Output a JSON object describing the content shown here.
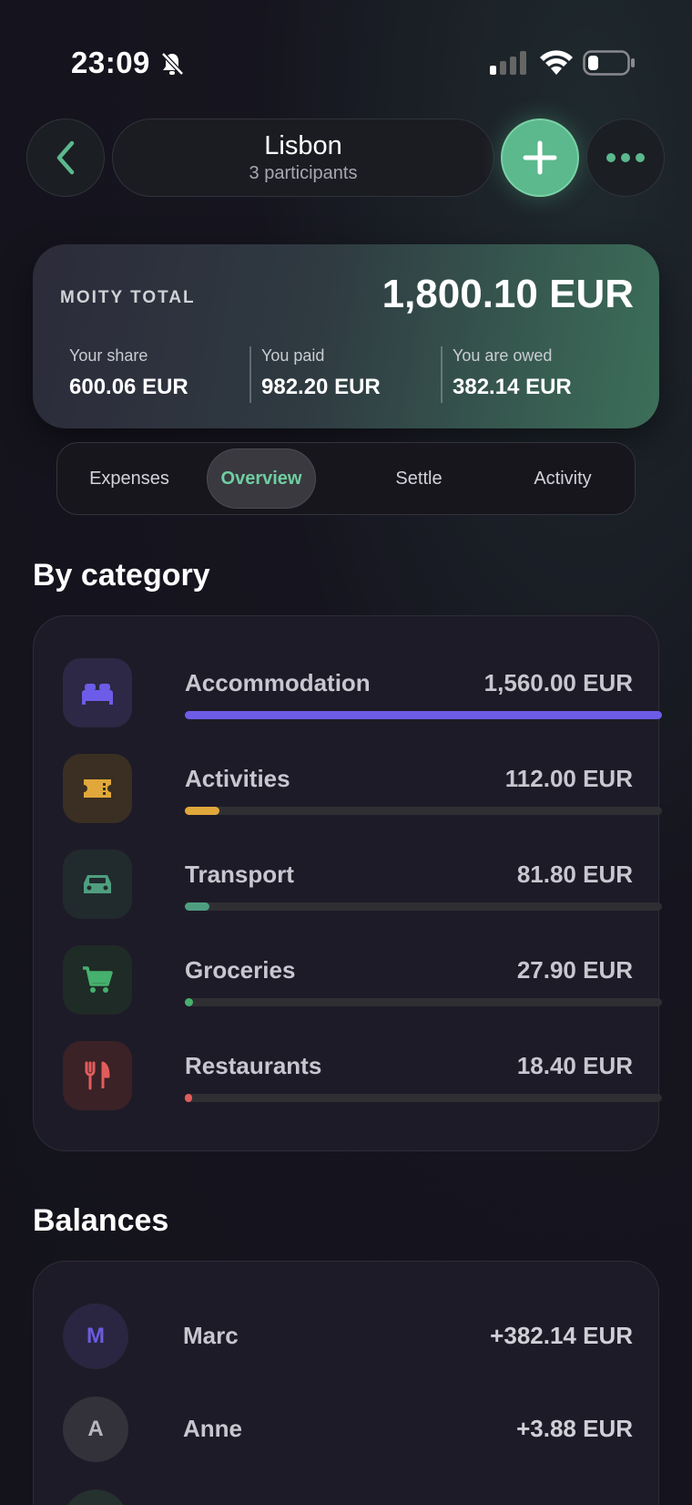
{
  "status_bar": {
    "time": "23:09",
    "icons": [
      "bell-slash-icon",
      "cellular-signal-icon",
      "wifi-icon",
      "battery-icon"
    ]
  },
  "header": {
    "title": "Lisbon",
    "subtitle": "3 participants",
    "buttons": [
      "back-chevron-icon",
      "plus-icon",
      "ellipsis-icon"
    ]
  },
  "summary": {
    "label": "MOITY TOTAL",
    "total": "1,800.10 EUR",
    "your_share_label": "Your share",
    "your_share": "600.06 EUR",
    "you_paid_label": "You paid",
    "you_paid": "982.20 EUR",
    "owed_label": "You are owed",
    "owed": "382.14 EUR"
  },
  "tabs": [
    "Expenses",
    "Overview",
    "Settle",
    "Activity"
  ],
  "active_tab": "Overview",
  "categories_title": "By category",
  "categories": [
    {
      "name": "Accommodation",
      "amount": "1,560.00 EUR",
      "share": 1.0,
      "icon": "bed-icon",
      "color": "#6c5ce7",
      "bg": "#2c2845"
    },
    {
      "name": "Activities",
      "amount": "112.00 EUR",
      "share": 0.072,
      "icon": "ticket-icon",
      "color": "#e0a83a",
      "bg": "#3a2f22"
    },
    {
      "name": "Transport",
      "amount": "81.80 EUR",
      "share": 0.052,
      "icon": "car-icon",
      "color": "#4f9e80",
      "bg": "#212b2e"
    },
    {
      "name": "Groceries",
      "amount": "27.90 EUR",
      "share": 0.018,
      "icon": "cart-icon",
      "color": "#46b06e",
      "bg": "#1f2b26"
    },
    {
      "name": "Restaurants",
      "amount": "18.40 EUR",
      "share": 0.012,
      "icon": "fork-knife-icon",
      "color": "#e25c5c",
      "bg": "#3a2226"
    }
  ],
  "balances_title": "Balances",
  "balances": [
    {
      "initial": "M",
      "name": "Marc",
      "amount": "+382.14 EUR",
      "color": "#6b5be0",
      "bg": "#2a2641"
    },
    {
      "initial": "A",
      "name": "Anne",
      "amount": "+3.88 EUR",
      "color": "#b8b6be",
      "bg": "#33313a"
    }
  ],
  "colors": {
    "accent": "#5cb88d",
    "background": "#14131c"
  }
}
